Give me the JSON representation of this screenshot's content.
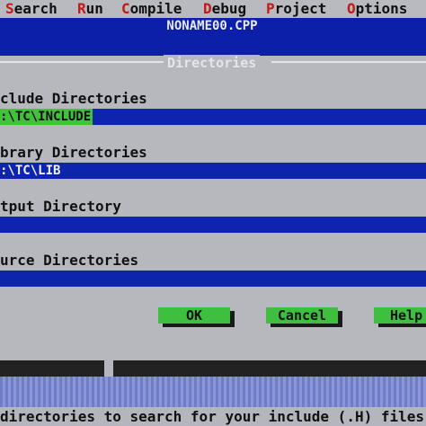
{
  "menu": {
    "items": [
      {
        "hot": "S",
        "rest": "earch"
      },
      {
        "hot": "R",
        "rest": "un"
      },
      {
        "hot": "C",
        "rest": "ompile"
      },
      {
        "hot": "D",
        "rest": "ebug"
      },
      {
        "hot": "P",
        "rest": "roject"
      },
      {
        "hot": "O",
        "rest": "ptions"
      }
    ]
  },
  "editor": {
    "file_title": "NONAME00.CPP"
  },
  "dialog": {
    "title": "Directories",
    "include": {
      "label": "clude Directories",
      "value": ":\\TC\\INCLUDE"
    },
    "library": {
      "label": "brary Directories",
      "value": ":\\TC\\LIB"
    },
    "output": {
      "label": "tput Directory",
      "value": ""
    },
    "source": {
      "label": "urce Directories",
      "value": ""
    },
    "buttons": {
      "ok": "OK",
      "cancel": "Cancel",
      "help": "Help"
    }
  },
  "status": {
    "text": "directories to search for your include (.H) files"
  },
  "colors": {
    "background_blue": "#0a20a6",
    "dialog_gray": "#b7b7be",
    "button_green": "#3fbf3f",
    "hotkey_red": "#c41818"
  }
}
